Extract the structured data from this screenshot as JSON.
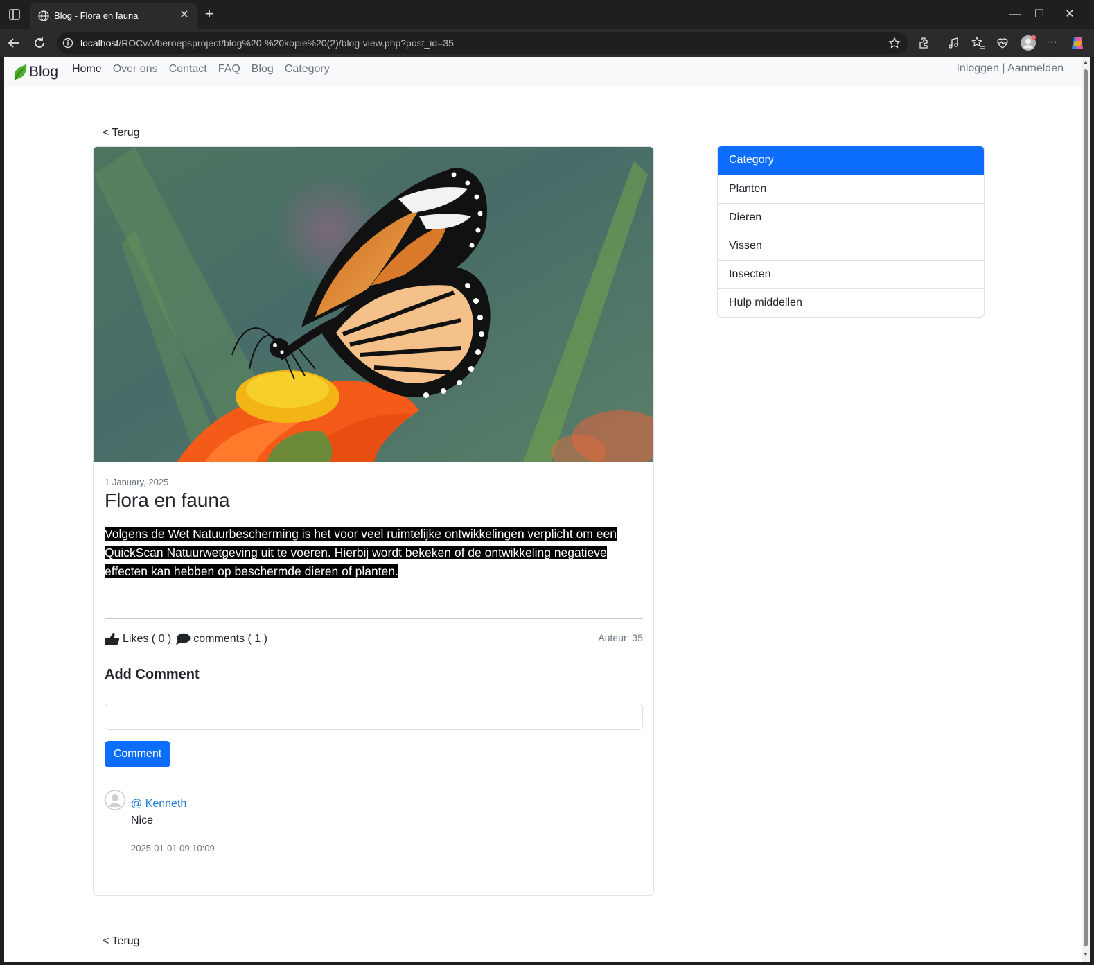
{
  "browser": {
    "tab_title": "Blog - Flora en fauna",
    "url_host": "localhost",
    "url_path": "/ROCvA/beroepsproject/blog%20-%20kopie%20(2)/blog-view.php?post_id=35"
  },
  "nav": {
    "brand": "Blog",
    "links": [
      "Home",
      "Over ons",
      "Contact",
      "FAQ",
      "Blog",
      "Category"
    ],
    "login": "Inloggen",
    "separator": "|",
    "register": "Aanmelden"
  },
  "post": {
    "back_label": "< Terug",
    "date": "1 January, 2025",
    "title": "Flora en fauna",
    "body_lines": [
      "Volgens de Wet Natuurbescherming is het voor veel ruimtelijke ontwikkelingen verplicht om een",
      "QuickScan Natuurwetgeving uit te voeren. Hierbij wordt bekeken of de ontwikkeling negatieve",
      "effecten kan hebben op beschermde dieren of planten."
    ],
    "likes_label": "Likes ( 0 )",
    "comments_label": "comments ( 1 )",
    "author_label": "Auteur: 35",
    "add_comment_title": "Add Comment",
    "comment_input_value": "",
    "comment_button": "Comment",
    "comments": [
      {
        "user": "@ Kenneth",
        "text": "Nice",
        "time": "2025-01-01 09:10:09"
      }
    ]
  },
  "sidebar": {
    "header": "Category",
    "items": [
      "Planten",
      "Dieren",
      "Vissen",
      "Insecten",
      "Hulp middellen"
    ]
  },
  "colors": {
    "primary": "#0d6efd",
    "link": "#1a7ad4",
    "navbar_bg": "#f8f9fa"
  }
}
